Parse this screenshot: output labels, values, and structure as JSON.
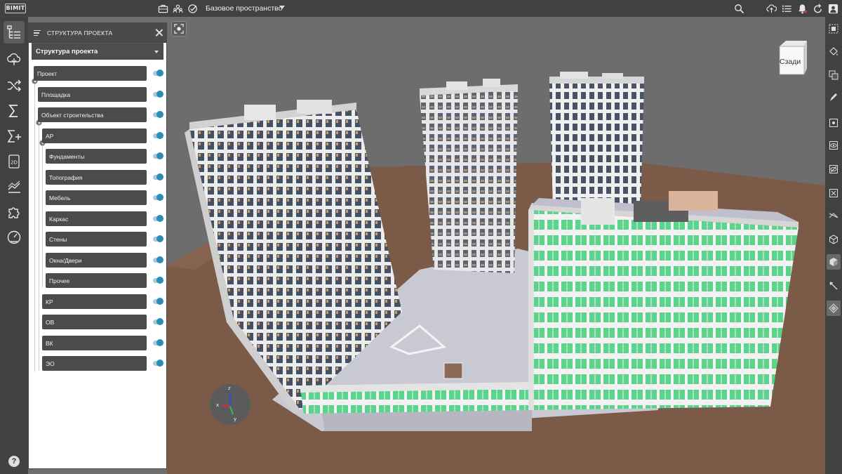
{
  "topbar": {
    "logo": "BIMIT",
    "space_label": "Базовое пространство",
    "left_icons": [
      "briefcase-icon",
      "users-icon",
      "checklist-icon"
    ],
    "right_icons": [
      "search-icon",
      "cloud-icon",
      "list-icon",
      "bell-icon",
      "refresh-icon",
      "user-icon"
    ]
  },
  "left_toolbar": {
    "items": [
      "project-structure-icon",
      "cloud-tree-icon",
      "shuffle-icon",
      "sum-icon",
      "sum-plus-icon",
      "2d-icon",
      "chart-lines-icon",
      "puzzle-icon",
      "gauge-icon"
    ],
    "icon_2d_text": "2D",
    "help": "?"
  },
  "panel": {
    "header_title": "СТРУКТУРА ПРОЕКТА",
    "dropdown_label": "Структура проекта",
    "nodes": [
      {
        "label": "Проект",
        "on": true
      },
      {
        "label": "Площадка",
        "on": true
      },
      {
        "label": "Объект строительства",
        "on": true
      },
      {
        "label": "АР",
        "on": true
      },
      {
        "label": "Фундаменты",
        "on": true
      },
      {
        "label": "Топография",
        "on": true
      },
      {
        "label": "Мебель",
        "on": true
      },
      {
        "label": "Каркас",
        "on": true
      },
      {
        "label": "Стены",
        "on": true
      },
      {
        "label": "Окна/Двери",
        "on": true
      },
      {
        "label": "Прочее",
        "on": true
      },
      {
        "label": "КР",
        "on": true
      },
      {
        "label": "ОВ",
        "on": true
      },
      {
        "label": "ВК",
        "on": true
      },
      {
        "label": "ЭО",
        "on": true
      }
    ]
  },
  "viewport": {
    "navcube_label": "Сзади",
    "axes": {
      "z": "z",
      "x": "x",
      "y": "y"
    }
  },
  "right_toolbar": {
    "items": [
      "select-box-icon",
      "paint-bucket-icon",
      "copy-select-icon",
      "pen-icon",
      "hide-icon",
      "eye-icon",
      "eye-off-icon",
      "isolate-icon",
      "section-icon",
      "cube-icon",
      "shade-cube-icon",
      "measure-icon",
      "target-icon"
    ]
  },
  "colors": {
    "toolbar_bg": "#414141",
    "toggle_accent": "#2b8db6",
    "ground": "#7a5a47",
    "facade_glass_green": "#59d685",
    "facade_dark": "#4a5568"
  }
}
